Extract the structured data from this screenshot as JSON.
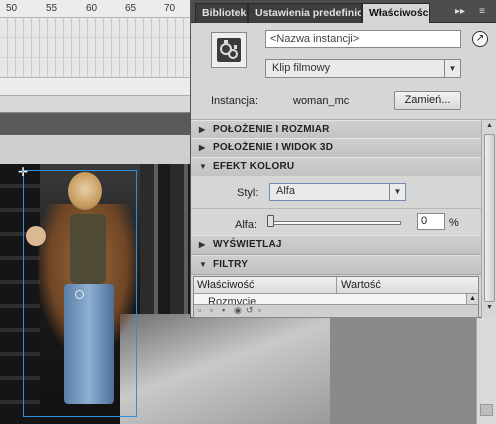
{
  "timeline": {
    "ruler_ticks": [
      "50",
      "55",
      "60",
      "65",
      "70"
    ]
  },
  "panel": {
    "tabs": [
      "Biblioteka",
      "Ustawienia predefiniow",
      "Właściwości"
    ],
    "active_tab": "Właściwości",
    "tab_controls": [
      "▸▸",
      "≡"
    ],
    "instance_name_placeholder": "<Nazwa instancji>",
    "symbol_type": "Klip filmowy",
    "instance_label": "Instancja:",
    "instance_value": "woman_mc",
    "swap_label": "Zamień...",
    "sections": {
      "position_size": "POŁOŻENIE I ROZMIAR",
      "position_3d": "POŁOŻENIE I WIDOK 3D",
      "color_effect": "EFEKT KOLORU",
      "display": "WYŚWIETLAJ",
      "filters": "FILTRY"
    },
    "color_effect": {
      "style_label": "Styl:",
      "style_value": "Alfa",
      "alpha_label": "Alfa:",
      "alpha_value": "0",
      "alpha_unit": "%"
    },
    "filters_table": {
      "col_property": "Właściwość",
      "col_value": "Wartość",
      "row": "Rozmycie"
    }
  },
  "icons": [
    "movie-clip-symbol-icon",
    "link-icon",
    "dropdown-arrow-icon",
    "expand-triangle-icon",
    "collapse-triangle-icon",
    "registration-point-icon",
    "transform-center-icon",
    "scroll-arrow-icon"
  ]
}
